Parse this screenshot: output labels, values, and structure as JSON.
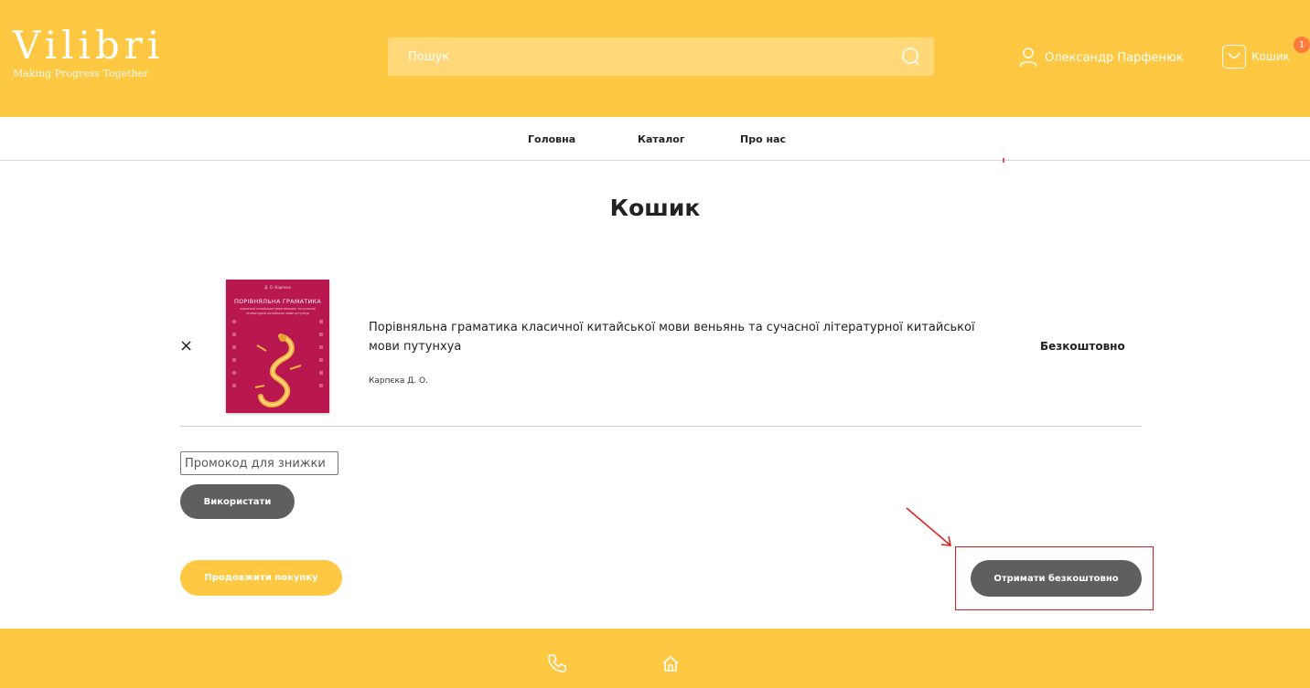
{
  "brand": {
    "name": "Vilibri",
    "tagline": "Making Progress Together"
  },
  "colors": {
    "brand_yellow": "#ffc843",
    "button_gray": "#5f5f5f",
    "cover_pink": "#b8184f",
    "annotation_red": "#e11c1c",
    "badge_orange": "#ff7a3d"
  },
  "search": {
    "placeholder": "Пошук",
    "icon": "search-icon"
  },
  "header": {
    "user_name": "Олександр Парфенюк",
    "cart_label": "Кошик",
    "cart_count": "1"
  },
  "nav": {
    "items": [
      {
        "label": "Головна"
      },
      {
        "label": "Каталог"
      },
      {
        "label": "Про нас"
      }
    ]
  },
  "page": {
    "title": "Кошик"
  },
  "cart": {
    "items": [
      {
        "remove_label": "×",
        "title": "Порівняльна граматика класичної китайської мови веньянь та сучасної літературної китайської мови путунхуа",
        "author": "Карпєка Д. О.",
        "price": "Безкоштовно",
        "cover": {
          "author": "Д. О. Карпєка",
          "title": "ПОРІВНЯЛЬНА ГРАМАТИКА",
          "subtitle": "класичної китайської мови веньянь та сучасної літературної китайської мови путунхуа"
        }
      }
    ]
  },
  "promo": {
    "placeholder": "Промокод для знижки",
    "apply_label": "Використати"
  },
  "actions": {
    "continue_label": "Продовжити покупку",
    "checkout_label": "Отримати безкоштовно"
  },
  "footer": {
    "icons": [
      "phone-icon",
      "home-icon"
    ]
  }
}
